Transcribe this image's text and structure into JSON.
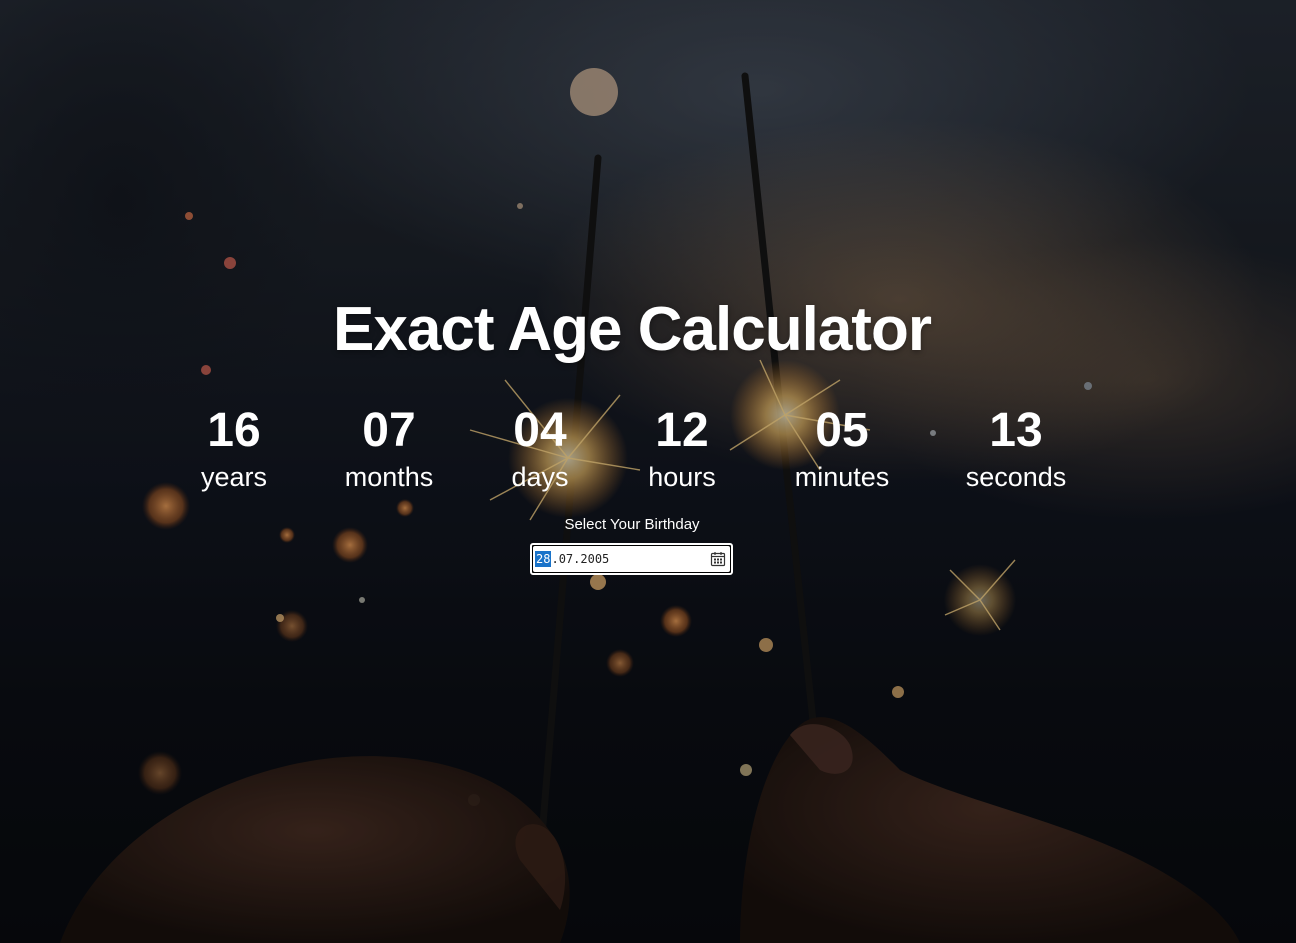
{
  "page": {
    "title": "Exact Age Calculator"
  },
  "age": {
    "units": [
      {
        "value": "16",
        "label": "years"
      },
      {
        "value": "07",
        "label": "months"
      },
      {
        "value": "04",
        "label": "days"
      },
      {
        "value": "12",
        "label": "hours"
      },
      {
        "value": "05",
        "label": "minutes"
      },
      {
        "value": "13",
        "label": "seconds"
      }
    ]
  },
  "birthday": {
    "label": "Select Your Birthday",
    "day": "28",
    "month": "07",
    "year": "2005",
    "separator": ".",
    "icon": "calendar-icon"
  },
  "colors": {
    "text": "#ffffff",
    "selection": "#1a73c9",
    "input_bg": "#ffffff"
  }
}
